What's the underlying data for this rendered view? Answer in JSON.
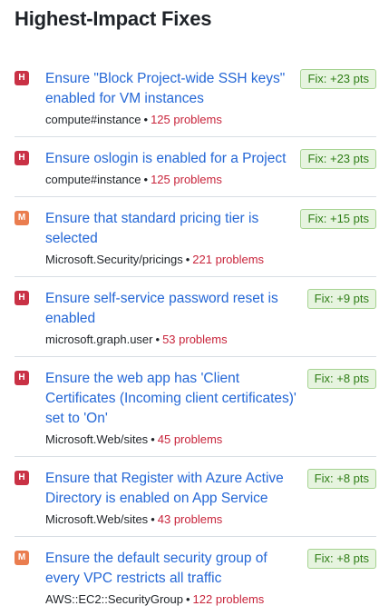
{
  "panel": {
    "title": "Highest-Impact Fixes"
  },
  "fixes": [
    {
      "severity": "high",
      "severity_label": "H",
      "title": "Ensure \"Block Project-wide SSH keys\" enabled for VM instances",
      "resource": "compute#instance",
      "separator": "•",
      "problems": "125 problems",
      "fix": "Fix: +23 pts"
    },
    {
      "severity": "high",
      "severity_label": "H",
      "title": "Ensure oslogin is enabled for a Project",
      "resource": "compute#instance",
      "separator": "•",
      "problems": "125 problems",
      "fix": "Fix: +23 pts"
    },
    {
      "severity": "medium",
      "severity_label": "M",
      "title": "Ensure that standard pricing tier is selected",
      "resource": "Microsoft.Security/pricings",
      "separator": "•",
      "problems": "221 problems",
      "fix": "Fix: +15 pts"
    },
    {
      "severity": "high",
      "severity_label": "H",
      "title": "Ensure self-service password reset is enabled",
      "resource": "microsoft.graph.user",
      "separator": "•",
      "problems": "53 problems",
      "fix": "Fix: +9 pts"
    },
    {
      "severity": "high",
      "severity_label": "H",
      "title": "Ensure the web app has 'Client Certificates (Incoming client certificates)' set to 'On'",
      "resource": "Microsoft.Web/sites",
      "separator": "•",
      "problems": "45 problems",
      "fix": "Fix: +8 pts"
    },
    {
      "severity": "high",
      "severity_label": "H",
      "title": "Ensure that Register with Azure Active Directory is enabled on App Service",
      "resource": "Microsoft.Web/sites",
      "separator": "•",
      "problems": "43 problems",
      "fix": "Fix: +8 pts"
    },
    {
      "severity": "medium",
      "severity_label": "M",
      "title": "Ensure the default security group of every VPC restricts all traffic",
      "resource": "AWS::EC2::SecurityGroup",
      "separator": "•",
      "problems": "122 problems",
      "fix": "Fix: +8 pts"
    }
  ],
  "colors": {
    "severity_high": "#c93145",
    "severity_medium": "#ea7d4f",
    "link": "#2467d6",
    "problems": "#c8243b",
    "fix_badge_bg": "#e6f4df",
    "fix_badge_text": "#2e7d15"
  }
}
